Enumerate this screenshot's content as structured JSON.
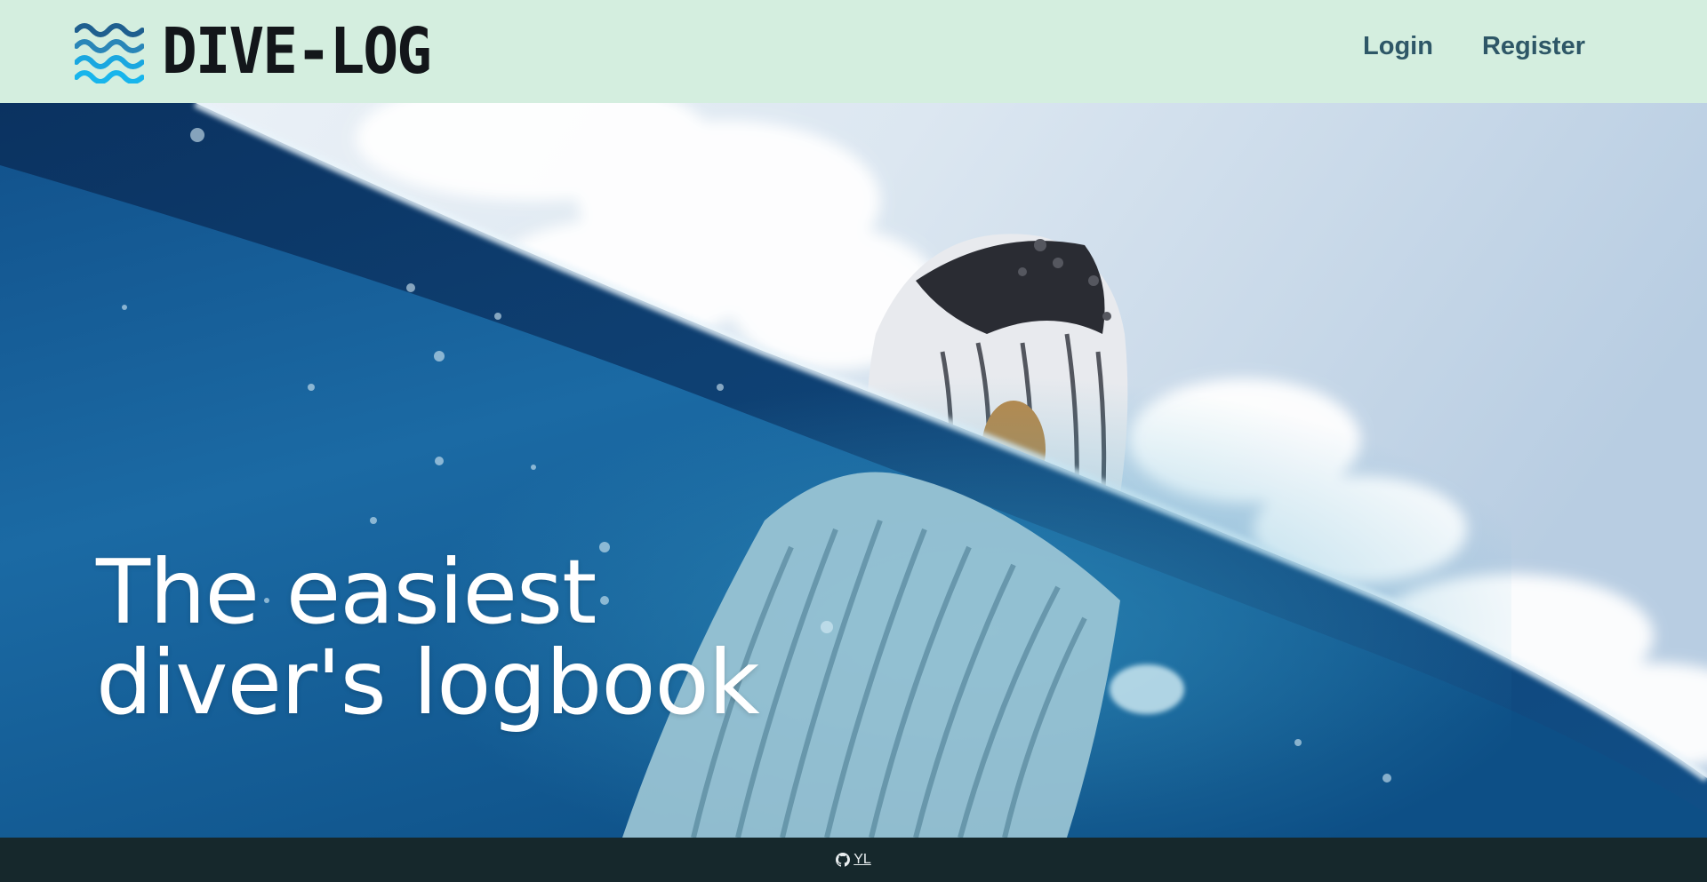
{
  "header": {
    "logo_text": "DIVE-LOG",
    "nav": {
      "login_label": "Login",
      "register_label": "Register"
    }
  },
  "hero": {
    "headline_line1": "The easiest",
    "headline_line2": "diver's logbook",
    "image_description_icon": "whale-surfacing-split-shot"
  },
  "footer": {
    "link_label": "YL",
    "link_icon": "github-icon"
  },
  "colors": {
    "header_bg": "#d4eedf",
    "nav_text": "#2e5767",
    "logo_text": "#13161a",
    "wave_dark": "#1f5f8f",
    "wave_light": "#1aa7e0",
    "footer_bg": "#16282c",
    "footer_text": "#e9eef0"
  }
}
